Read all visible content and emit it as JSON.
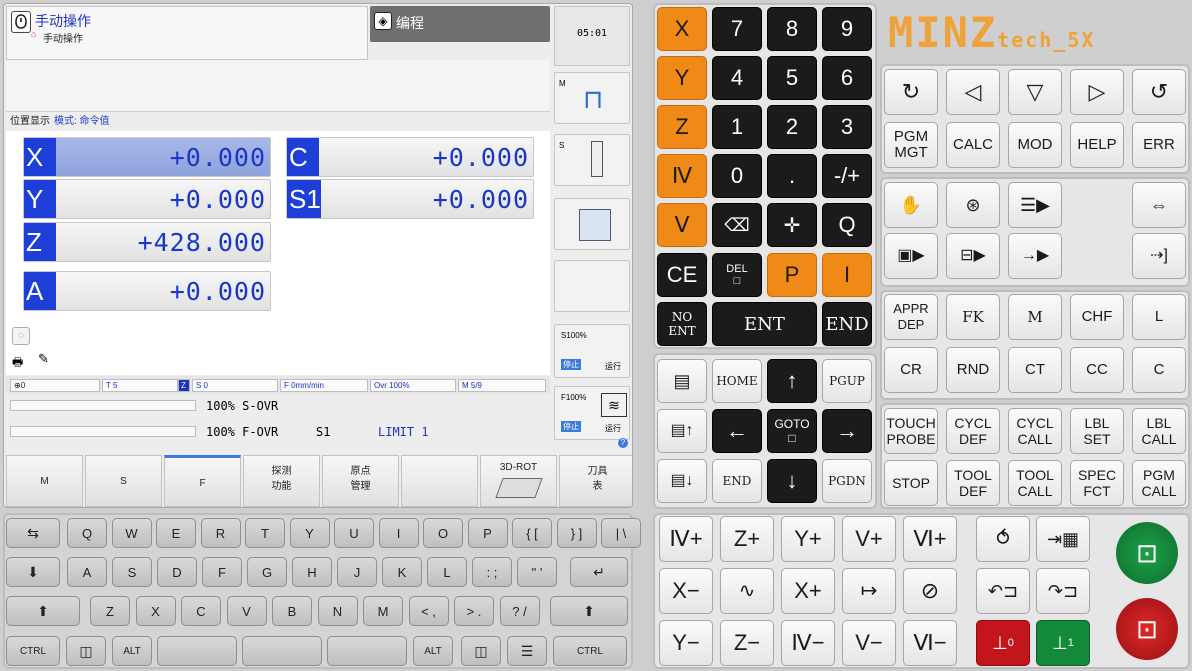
{
  "header": {
    "mode_title": "手动操作",
    "mode_subtitle": "手动操作",
    "program_tab": "编程",
    "clock": "05:01"
  },
  "position": {
    "label": "位置显示",
    "mode_label": "模式: 命令值",
    "axes": [
      {
        "name": "X",
        "value": "+0.000"
      },
      {
        "name": "Y",
        "value": "+0.000"
      },
      {
        "name": "Z",
        "value": "+428.000"
      },
      {
        "name": "A",
        "value": "+0.000"
      },
      {
        "name": "C",
        "value": "+0.000"
      },
      {
        "name": "S1",
        "value": "+0.000"
      }
    ]
  },
  "status": {
    "coord": "0",
    "tool": "T 5",
    "z_flag": "Z",
    "spindle": "S 0",
    "feed": "F 0mm/min",
    "ovr": "Ovr 100%",
    "m_func": "M 5/9",
    "s_ovr": "100% S-OVR",
    "f_ovr": "100% F-OVR",
    "s1": "S1",
    "limit": "LIMIT 1"
  },
  "side_softkeys": {
    "m_label": "M",
    "s_label": "S",
    "s100": "S100%",
    "f100": "F100%",
    "stop": "停止",
    "run": "运行"
  },
  "bottom_softkeys": [
    "M",
    "S",
    "F",
    "探测\n功能",
    "原点\n管理",
    "",
    "3D-ROT",
    "刀具\n表"
  ],
  "numpad": {
    "axes": [
      "X",
      "Y",
      "Z",
      "Ⅳ",
      "Ⅴ"
    ],
    "digits": [
      "7",
      "8",
      "9",
      "4",
      "5",
      "6",
      "1",
      "2",
      "3",
      "0",
      ".",
      "-/+"
    ],
    "ce": "CE",
    "del": "DEL",
    "p": "P",
    "i": "I",
    "q": "Q",
    "noent": "NO\nENT",
    "ent": "ENT",
    "end": "END"
  },
  "navpad": {
    "home": "HOME",
    "pgup": "PGUP",
    "goto": "GOTO",
    "end": "END",
    "pgdn": "PGDN"
  },
  "brand": {
    "main": "MINZ",
    "sub": "tech_5X"
  },
  "function_keys": {
    "row2": [
      "PGM\nMGT",
      "CALC",
      "MOD",
      "HELP",
      "ERR"
    ],
    "path": [
      "APPR\nDEP",
      "FK",
      "M",
      "CHF",
      "L",
      "CR",
      "RND",
      "CT",
      "CC",
      "C"
    ],
    "cycles": [
      "TOUCH\nPROBE",
      "CYCL\nDEF",
      "CYCL\nCALL",
      "LBL\nSET",
      "LBL\nCALL",
      "STOP",
      "TOOL\nDEF",
      "TOOL\nCALL",
      "SPEC\nFCT",
      "PGM\nCALL"
    ]
  },
  "jog": {
    "row1": [
      "Ⅳ+",
      "Z+",
      "Y+",
      "V+",
      "Ⅵ+"
    ],
    "row2": [
      "X−",
      "",
      "X+",
      "",
      ""
    ],
    "row3": [
      "Y−",
      "Z−",
      "Ⅳ−",
      "V−",
      "Ⅵ−"
    ],
    "spindle_off": "0",
    "spindle_on": "1"
  },
  "keyboard": {
    "row1": [
      "Q",
      "W",
      "E",
      "R",
      "T",
      "Y",
      "U",
      "I",
      "O",
      "P",
      "{ [",
      "} ]",
      "| \\"
    ],
    "row2": [
      "A",
      "S",
      "D",
      "F",
      "G",
      "H",
      "J",
      "K",
      "L",
      ": ;",
      "\" '"
    ],
    "row3": [
      "Z",
      "X",
      "C",
      "V",
      "B",
      "N",
      "M",
      "< ,",
      "> .",
      "? /"
    ],
    "ctrl": "CTRL",
    "alt": "ALT"
  }
}
